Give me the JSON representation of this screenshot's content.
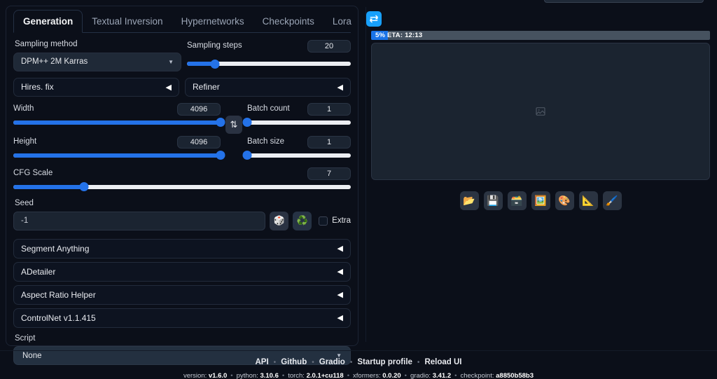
{
  "tabs": [
    {
      "label": "Generation",
      "active": true
    },
    {
      "label": "Textual Inversion",
      "active": false
    },
    {
      "label": "Hypernetworks",
      "active": false
    },
    {
      "label": "Checkpoints",
      "active": false
    },
    {
      "label": "Lora",
      "active": false
    }
  ],
  "refresh_button": {
    "icon": "refresh-icon",
    "color": "#18a0fb"
  },
  "sampling": {
    "method_label": "Sampling method",
    "method_value": "DPM++ 2M Karras",
    "steps_label": "Sampling steps",
    "steps_value": "20",
    "steps_percent": 17
  },
  "hires": {
    "label": "Hires. fix"
  },
  "refiner": {
    "label": "Refiner"
  },
  "dimensions": {
    "width_label": "Width",
    "width_value": "4096",
    "width_percent": 100,
    "height_label": "Height",
    "height_value": "4096",
    "height_percent": 100,
    "swap_icon": "⇅"
  },
  "batch": {
    "count_label": "Batch count",
    "count_value": "1",
    "count_percent": 0,
    "size_label": "Batch size",
    "size_value": "1",
    "size_percent": 0
  },
  "cfg": {
    "label": "CFG Scale",
    "value": "7",
    "percent": 21
  },
  "seed": {
    "label": "Seed",
    "value": "-1",
    "dice_icon": "🎲",
    "recycle_icon": "♻️",
    "extra_label": "Extra",
    "extra_checked": false
  },
  "accordions": [
    {
      "label": "Segment Anything"
    },
    {
      "label": "ADetailer"
    },
    {
      "label": "Aspect Ratio Helper"
    },
    {
      "label": "ControlNet v1.1.415"
    }
  ],
  "script": {
    "label": "Script",
    "value": "None"
  },
  "output": {
    "progress_text": "5% ETA: 12:13",
    "progress_percent": 5,
    "placeholder_icon": "image-placeholder-icon",
    "tools": [
      {
        "name": "open-folder-button",
        "icon": "📂"
      },
      {
        "name": "save-button",
        "icon": "💾"
      },
      {
        "name": "save-zip-button",
        "icon": "🗃️"
      },
      {
        "name": "send-to-img2img-button",
        "icon": "🖼️"
      },
      {
        "name": "send-to-inpaint-button",
        "icon": "🎨"
      },
      {
        "name": "send-to-extras-button",
        "icon": "📐"
      },
      {
        "name": "send-to-sketch-button",
        "icon": "🖌️"
      }
    ]
  },
  "footer": {
    "links": [
      "API",
      "Github",
      "Gradio",
      "Startup profile",
      "Reload UI"
    ],
    "separator": "•",
    "version_items": [
      {
        "key": "version: ",
        "val": "v1.6.0"
      },
      {
        "key": "python: ",
        "val": "3.10.6"
      },
      {
        "key": "torch: ",
        "val": "2.0.1+cu118"
      },
      {
        "key": "xformers: ",
        "val": "0.0.20"
      },
      {
        "key": "gradio: ",
        "val": "3.41.2"
      },
      {
        "key": "checkpoint: ",
        "val": "a8850b58b3"
      }
    ]
  }
}
